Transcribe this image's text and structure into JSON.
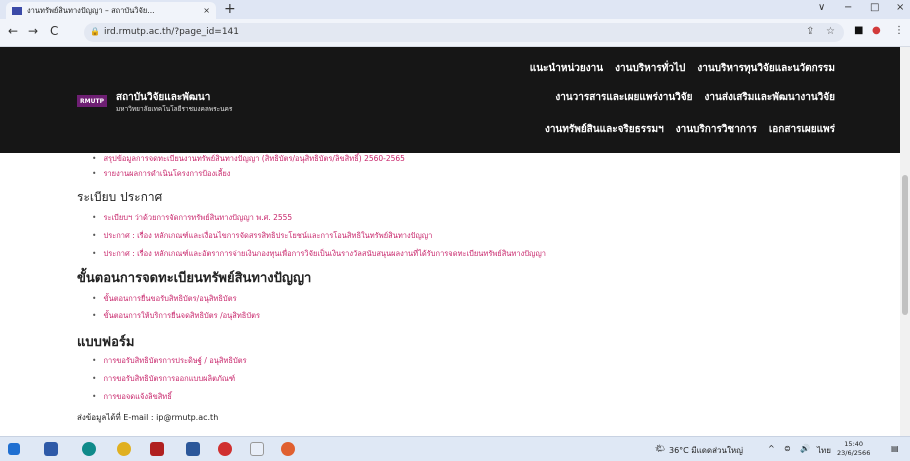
{
  "browser": {
    "tab_title": "งานทรัพย์สินทางปัญญา – สถาบันวิจัย...",
    "tab_close": "×",
    "new_tab": "+",
    "url": "ird.rmutp.ac.th/?page_id=141",
    "window_controls": [
      "∨",
      "−",
      "□",
      "×"
    ]
  },
  "site": {
    "logo_text": "RMUTP",
    "title": "สถาบันวิจัยและพัฒนา",
    "subtitle": "มหาวิทยาลัยเทคโนโลยีราชมงคลพระนคร",
    "menu_rows": [
      [
        "แนะนำหน่วยงาน",
        "งานบริหารทั่วไป",
        "งานบริหารทุนวิจัยและนวัตกรรม"
      ],
      [
        "งานวารสารและเผยแพร่งานวิจัย",
        "งานส่งเสริมและพัฒนางานวิจัย"
      ],
      [
        "งานทรัพย์สินและจริยธรรมฯ",
        "งานบริการวิชาการ",
        "เอกสารเผยแพร่"
      ]
    ]
  },
  "content": {
    "report_items": [
      "สรุปข้อมูลการจดทะเบียนงานทรัพย์สินทางปัญญา (สิทธิบัตร/อนุสิทธิบัตร/ลิขสิทธิ์) 2560-2565",
      "รายงานผลการดำเนินโครงการป้องเลี้ยง"
    ],
    "rules_heading": "ระเบียบ ประกาศ",
    "rules_items": [
      "ระเบียบฯ ว่าด้วยการจัดการทรัพย์สินทางปัญญา พ.ศ. 2555",
      "ประกาศ : เรื่อง หลักเกณฑ์และเงื่อนไขการจัดสรรสิทธิประโยชน์และการโอนสิทธิในทรัพย์สินทางปัญญา",
      "ประกาศ : เรื่อง หลักเกณฑ์และอัตราการจ่ายเงินกองทุนเพื่อการวิจัยเป็นเงินรางวัลสนับสนุนผลงานที่ได้รับการจดทะเบียนทรัพย์สินทางปัญญา"
    ],
    "procedure_heading": "ขั้นตอนการจดทะเบียนทรัพย์สินทางปัญญา",
    "procedure_items": [
      "ขั้นตอนการยื่นขอรับสิทธิบัตร/อนุสิทธิบัตร",
      "ขั้นตอนการให้บริการยื่นจดสิทธิบัตร /อนุสิทธิบัตร"
    ],
    "forms_heading": "แบบฟอร์ม",
    "forms_items": [
      "การขอรับสิทธิบัตรการประดิษฐ์ / อนุสิทธิบัตร",
      "การขอรับสิทธิบัตรการออกแบบผลิตภัณฑ์",
      "การขอจดแจ้งลิขสิทธิ์"
    ],
    "email_line": "ส่งข้อมูลได้ที่ E-mail : ip@rmutp.ac.th"
  },
  "taskbar": {
    "weather": "36°C มีแดดส่วนใหญ่",
    "language": "ไทย",
    "time": "15:40",
    "date": "23/6/2566"
  },
  "colors": {
    "link": "#c8256b",
    "header_bg": "#161616",
    "logo_bg": "#6e1f73"
  }
}
